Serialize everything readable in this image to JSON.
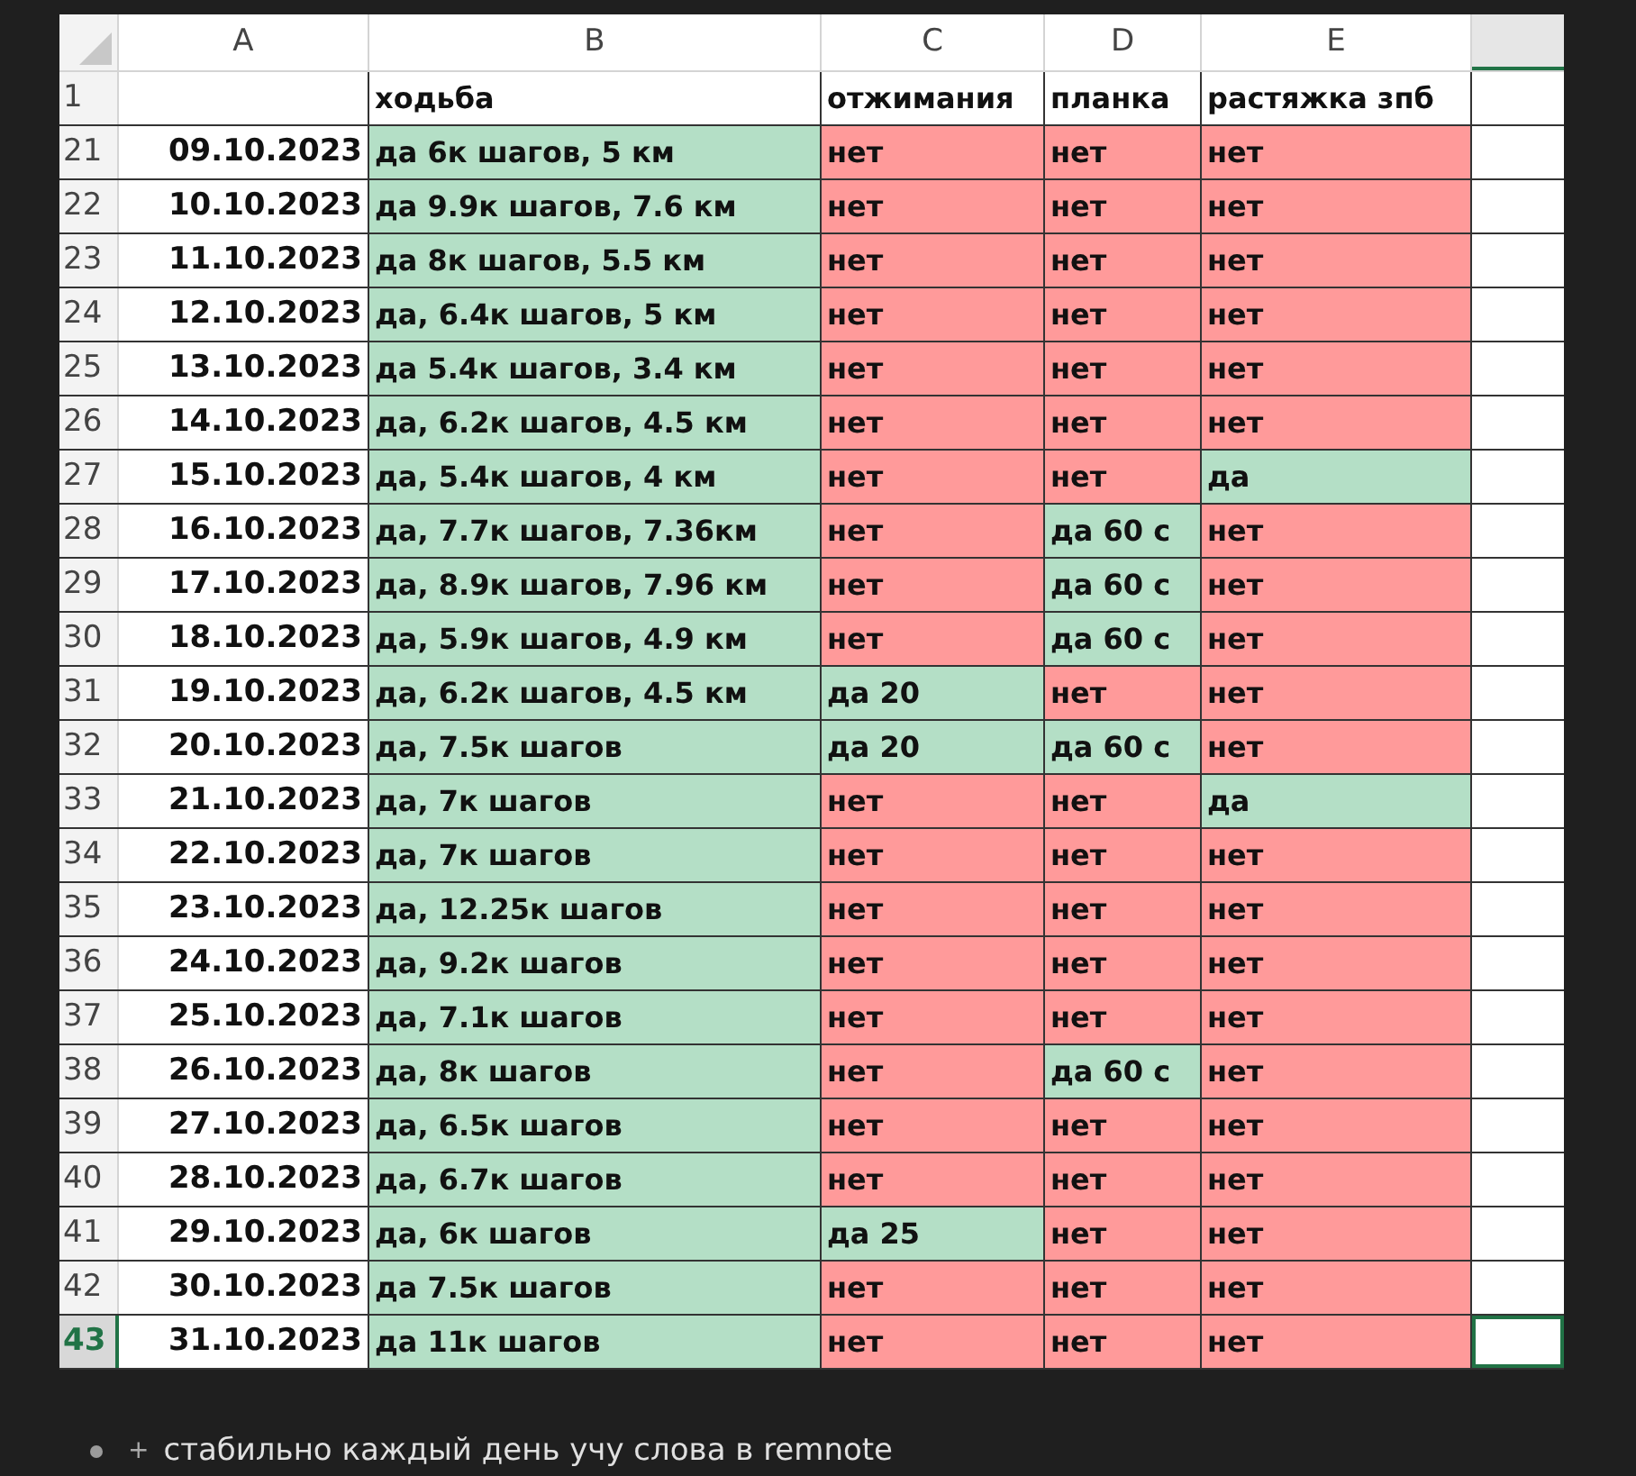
{
  "sheet": {
    "columns": [
      "A",
      "B",
      "C",
      "D",
      "E"
    ],
    "header_row": {
      "number": "1",
      "cells": [
        "",
        "ходьба",
        "отжимания",
        "планка",
        "растяжка зпб"
      ]
    },
    "rows": [
      {
        "number": "21",
        "selected": false,
        "cells": [
          {
            "kind": "date",
            "text": "09.10.2023"
          },
          {
            "kind": "status",
            "text": "да 6к шагов, 5 км",
            "done": true
          },
          {
            "kind": "status",
            "text": "нет",
            "done": false
          },
          {
            "kind": "status",
            "text": "нет",
            "done": false
          },
          {
            "kind": "status",
            "text": "нет",
            "done": false
          }
        ]
      },
      {
        "number": "22",
        "selected": false,
        "cells": [
          {
            "kind": "date",
            "text": "10.10.2023"
          },
          {
            "kind": "status",
            "text": "да 9.9к шагов, 7.6 км",
            "done": true
          },
          {
            "kind": "status",
            "text": "нет",
            "done": false
          },
          {
            "kind": "status",
            "text": "нет",
            "done": false
          },
          {
            "kind": "status",
            "text": "нет",
            "done": false
          }
        ]
      },
      {
        "number": "23",
        "selected": false,
        "cells": [
          {
            "kind": "date",
            "text": "11.10.2023"
          },
          {
            "kind": "status",
            "text": "да 8к шагов, 5.5 км",
            "done": true
          },
          {
            "kind": "status",
            "text": "нет",
            "done": false
          },
          {
            "kind": "status",
            "text": "нет",
            "done": false
          },
          {
            "kind": "status",
            "text": "нет",
            "done": false
          }
        ]
      },
      {
        "number": "24",
        "selected": false,
        "cells": [
          {
            "kind": "date",
            "text": "12.10.2023"
          },
          {
            "kind": "status",
            "text": "да, 6.4к шагов, 5 км",
            "done": true
          },
          {
            "kind": "status",
            "text": "нет",
            "done": false
          },
          {
            "kind": "status",
            "text": "нет",
            "done": false
          },
          {
            "kind": "status",
            "text": "нет",
            "done": false
          }
        ]
      },
      {
        "number": "25",
        "selected": false,
        "cells": [
          {
            "kind": "date",
            "text": "13.10.2023"
          },
          {
            "kind": "status",
            "text": "да 5.4к шагов, 3.4 км",
            "done": true
          },
          {
            "kind": "status",
            "text": "нет",
            "done": false
          },
          {
            "kind": "status",
            "text": "нет",
            "done": false
          },
          {
            "kind": "status",
            "text": "нет",
            "done": false
          }
        ]
      },
      {
        "number": "26",
        "selected": false,
        "cells": [
          {
            "kind": "date",
            "text": "14.10.2023"
          },
          {
            "kind": "status",
            "text": "да, 6.2к шагов, 4.5 км",
            "done": true
          },
          {
            "kind": "status",
            "text": "нет",
            "done": false
          },
          {
            "kind": "status",
            "text": "нет",
            "done": false
          },
          {
            "kind": "status",
            "text": "нет",
            "done": false
          }
        ]
      },
      {
        "number": "27",
        "selected": false,
        "cells": [
          {
            "kind": "date",
            "text": "15.10.2023"
          },
          {
            "kind": "status",
            "text": "да, 5.4к шагов, 4 км",
            "done": true
          },
          {
            "kind": "status",
            "text": "нет",
            "done": false
          },
          {
            "kind": "status",
            "text": "нет",
            "done": false
          },
          {
            "kind": "status",
            "text": "да",
            "done": true
          }
        ]
      },
      {
        "number": "28",
        "selected": false,
        "cells": [
          {
            "kind": "date",
            "text": "16.10.2023"
          },
          {
            "kind": "status",
            "text": "да, 7.7к шагов, 7.36км",
            "done": true
          },
          {
            "kind": "status",
            "text": "нет",
            "done": false
          },
          {
            "kind": "status",
            "text": "да 60 с",
            "done": true
          },
          {
            "kind": "status",
            "text": "нет",
            "done": false
          }
        ]
      },
      {
        "number": "29",
        "selected": false,
        "cells": [
          {
            "kind": "date",
            "text": "17.10.2023"
          },
          {
            "kind": "status",
            "text": "да, 8.9к шагов, 7.96 км",
            "done": true
          },
          {
            "kind": "status",
            "text": "нет",
            "done": false
          },
          {
            "kind": "status",
            "text": "да 60 с",
            "done": true
          },
          {
            "kind": "status",
            "text": "нет",
            "done": false
          }
        ]
      },
      {
        "number": "30",
        "selected": false,
        "cells": [
          {
            "kind": "date",
            "text": "18.10.2023"
          },
          {
            "kind": "status",
            "text": "да, 5.9к шагов, 4.9 км",
            "done": true
          },
          {
            "kind": "status",
            "text": "нет",
            "done": false
          },
          {
            "kind": "status",
            "text": "да 60 с",
            "done": true
          },
          {
            "kind": "status",
            "text": "нет",
            "done": false
          }
        ]
      },
      {
        "number": "31",
        "selected": false,
        "cells": [
          {
            "kind": "date",
            "text": "19.10.2023"
          },
          {
            "kind": "status",
            "text": "да, 6.2к шагов, 4.5 км",
            "done": true
          },
          {
            "kind": "status",
            "text": "да 20",
            "done": true
          },
          {
            "kind": "status",
            "text": "нет",
            "done": false
          },
          {
            "kind": "status",
            "text": "нет",
            "done": false
          }
        ]
      },
      {
        "number": "32",
        "selected": false,
        "cells": [
          {
            "kind": "date",
            "text": "20.10.2023"
          },
          {
            "kind": "status",
            "text": "да, 7.5к шагов",
            "done": true
          },
          {
            "kind": "status",
            "text": "да 20",
            "done": true
          },
          {
            "kind": "status",
            "text": "да 60 с",
            "done": true
          },
          {
            "kind": "status",
            "text": "нет",
            "done": false
          }
        ]
      },
      {
        "number": "33",
        "selected": false,
        "cells": [
          {
            "kind": "date",
            "text": "21.10.2023"
          },
          {
            "kind": "status",
            "text": "да, 7к шагов",
            "done": true
          },
          {
            "kind": "status",
            "text": "нет",
            "done": false
          },
          {
            "kind": "status",
            "text": "нет",
            "done": false
          },
          {
            "kind": "status",
            "text": "да",
            "done": true
          }
        ]
      },
      {
        "number": "34",
        "selected": false,
        "cells": [
          {
            "kind": "date",
            "text": "22.10.2023"
          },
          {
            "kind": "status",
            "text": "да, 7к шагов",
            "done": true
          },
          {
            "kind": "status",
            "text": "нет",
            "done": false
          },
          {
            "kind": "status",
            "text": "нет",
            "done": false
          },
          {
            "kind": "status",
            "text": "нет",
            "done": false
          }
        ]
      },
      {
        "number": "35",
        "selected": false,
        "cells": [
          {
            "kind": "date",
            "text": "23.10.2023"
          },
          {
            "kind": "status",
            "text": "да, 12.25к шагов",
            "done": true
          },
          {
            "kind": "status",
            "text": "нет",
            "done": false
          },
          {
            "kind": "status",
            "text": "нет",
            "done": false
          },
          {
            "kind": "status",
            "text": "нет",
            "done": false
          }
        ]
      },
      {
        "number": "36",
        "selected": false,
        "cells": [
          {
            "kind": "date",
            "text": "24.10.2023"
          },
          {
            "kind": "status",
            "text": "да, 9.2к шагов",
            "done": true
          },
          {
            "kind": "status",
            "text": "нет",
            "done": false
          },
          {
            "kind": "status",
            "text": "нет",
            "done": false
          },
          {
            "kind": "status",
            "text": "нет",
            "done": false
          }
        ]
      },
      {
        "number": "37",
        "selected": false,
        "cells": [
          {
            "kind": "date",
            "text": "25.10.2023"
          },
          {
            "kind": "status",
            "text": "да, 7.1к шагов",
            "done": true
          },
          {
            "kind": "status",
            "text": "нет",
            "done": false
          },
          {
            "kind": "status",
            "text": "нет",
            "done": false
          },
          {
            "kind": "status",
            "text": "нет",
            "done": false
          }
        ]
      },
      {
        "number": "38",
        "selected": false,
        "cells": [
          {
            "kind": "date",
            "text": "26.10.2023"
          },
          {
            "kind": "status",
            "text": "да, 8к шагов",
            "done": true
          },
          {
            "kind": "status",
            "text": "нет",
            "done": false
          },
          {
            "kind": "status",
            "text": "да 60 с",
            "done": true
          },
          {
            "kind": "status",
            "text": "нет",
            "done": false
          }
        ]
      },
      {
        "number": "39",
        "selected": false,
        "cells": [
          {
            "kind": "date",
            "text": "27.10.2023"
          },
          {
            "kind": "status",
            "text": "да, 6.5к шагов",
            "done": true
          },
          {
            "kind": "status",
            "text": "нет",
            "done": false
          },
          {
            "kind": "status",
            "text": "нет",
            "done": false
          },
          {
            "kind": "status",
            "text": "нет",
            "done": false
          }
        ]
      },
      {
        "number": "40",
        "selected": false,
        "cells": [
          {
            "kind": "date",
            "text": "28.10.2023"
          },
          {
            "kind": "status",
            "text": "да, 6.7к шагов",
            "done": true
          },
          {
            "kind": "status",
            "text": "нет",
            "done": false
          },
          {
            "kind": "status",
            "text": "нет",
            "done": false
          },
          {
            "kind": "status",
            "text": "нет",
            "done": false
          }
        ]
      },
      {
        "number": "41",
        "selected": false,
        "cells": [
          {
            "kind": "date",
            "text": "29.10.2023"
          },
          {
            "kind": "status",
            "text": "да, 6к шагов",
            "done": true
          },
          {
            "kind": "status",
            "text": "да 25",
            "done": true
          },
          {
            "kind": "status",
            "text": "нет",
            "done": false
          },
          {
            "kind": "status",
            "text": "нет",
            "done": false
          }
        ]
      },
      {
        "number": "42",
        "selected": false,
        "cells": [
          {
            "kind": "date",
            "text": "30.10.2023"
          },
          {
            "kind": "status",
            "text": "да 7.5к шагов",
            "done": true
          },
          {
            "kind": "status",
            "text": "нет",
            "done": false
          },
          {
            "kind": "status",
            "text": "нет",
            "done": false
          },
          {
            "kind": "status",
            "text": "нет",
            "done": false
          }
        ]
      },
      {
        "number": "43",
        "selected": true,
        "cells": [
          {
            "kind": "date",
            "text": "31.10.2023"
          },
          {
            "kind": "status",
            "text": "да 11к шагов",
            "done": true
          },
          {
            "kind": "status",
            "text": "нет",
            "done": false
          },
          {
            "kind": "status",
            "text": "нет",
            "done": false
          },
          {
            "kind": "status",
            "text": "нет",
            "done": false
          }
        ]
      }
    ]
  },
  "bullet": {
    "marker": "+",
    "text": "стабильно каждый день учу слова в remnote"
  }
}
